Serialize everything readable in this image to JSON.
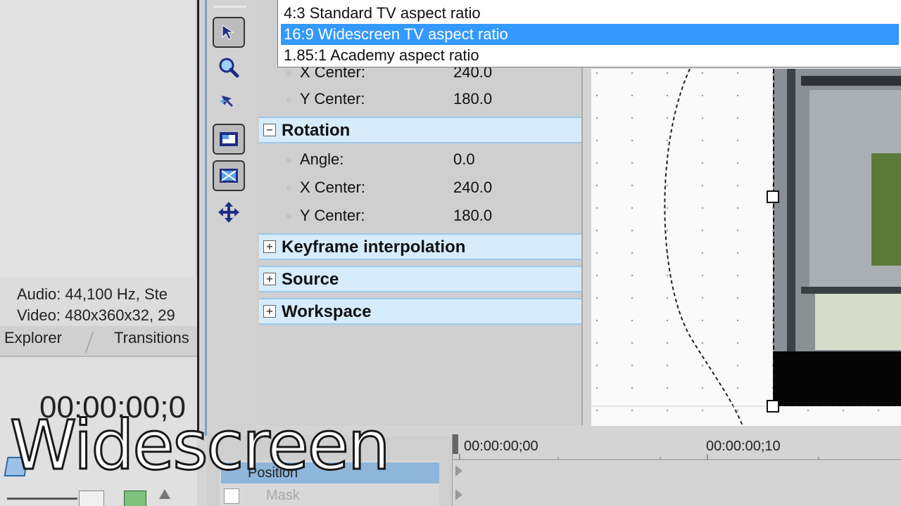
{
  "left_pane": {
    "audio_info": "Audio: 44,100 Hz, Ste",
    "video_info": "Video: 480x360x32, 29",
    "tabs": [
      {
        "label": "Explorer"
      },
      {
        "label": "Transitions"
      }
    ],
    "timecode": "00:00:00;0"
  },
  "tools": [
    {
      "icon": "pointer-arrow-icon"
    },
    {
      "icon": "zoom-magnifier-icon"
    },
    {
      "icon": "normal-edit-icon"
    },
    {
      "icon": "enable-snapping-icon"
    },
    {
      "icon": "lock-aspect-icon"
    },
    {
      "icon": "move-freely-icon"
    }
  ],
  "dropdown": {
    "items": [
      {
        "label": "4:3 Standard TV aspect ratio",
        "selected": false
      },
      {
        "label": "16:9 Widescreen TV aspect ratio",
        "selected": true
      },
      {
        "label": "1.85:1 Academy aspect ratio",
        "selected": false
      }
    ]
  },
  "properties": {
    "position_rows": [
      {
        "label": "X Center:",
        "value": "240.0"
      },
      {
        "label": "Y Center:",
        "value": "180.0"
      }
    ],
    "rotation": {
      "title": "Rotation",
      "toggle": "−",
      "rows": [
        {
          "label": "Angle:",
          "value": "0.0"
        },
        {
          "label": "X Center:",
          "value": "240.0"
        },
        {
          "label": "Y Center:",
          "value": "180.0"
        }
      ]
    },
    "sections": [
      {
        "title": "Keyframe interpolation",
        "toggle": "+"
      },
      {
        "title": "Source",
        "toggle": "+"
      },
      {
        "title": "Workspace",
        "toggle": "+"
      }
    ]
  },
  "track_list": {
    "position_label": "Position",
    "mask_label": "Mask"
  },
  "timeline": {
    "start_label": "00:00:00;00",
    "mark_label": "00:00:00;10"
  },
  "overlay": {
    "title": "Widescreen"
  },
  "colors": {
    "selection": "#3399ff",
    "section_band": "#d6ecfd",
    "track_highlight": "#8fb6da"
  }
}
